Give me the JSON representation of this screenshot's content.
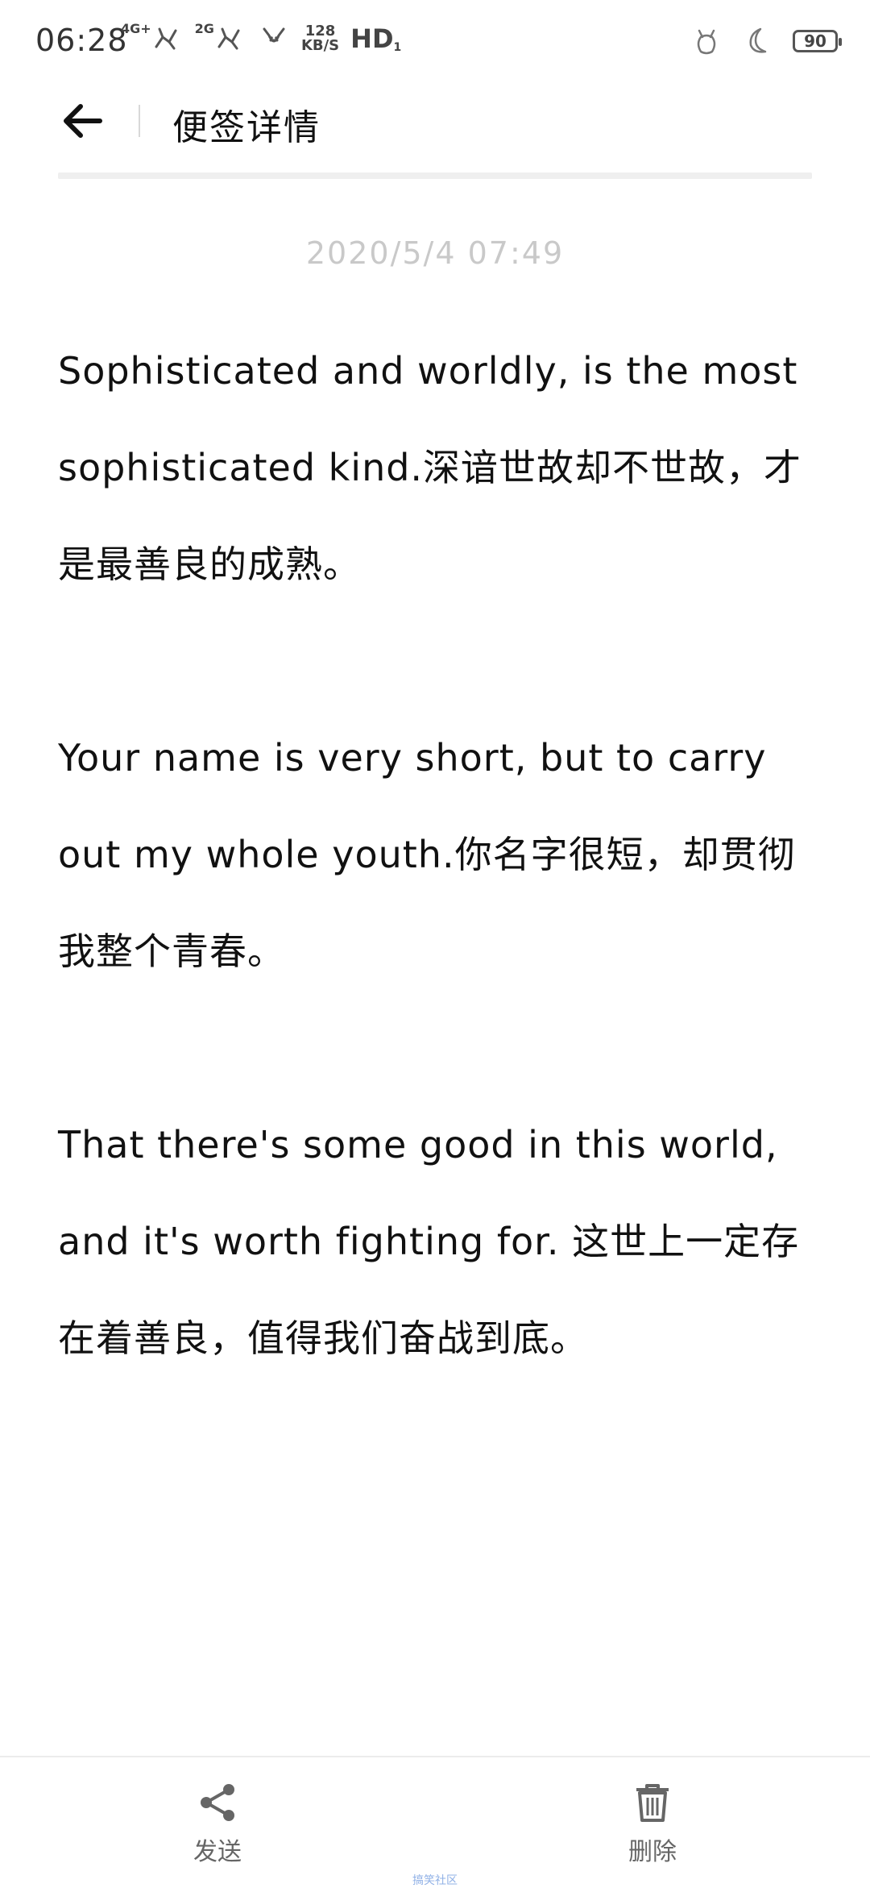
{
  "status_bar": {
    "time": "06:28",
    "net1": "4G+",
    "net2": "2G",
    "speed_value": "128",
    "speed_unit": "KB/S",
    "hd": "HD",
    "hd_sub": "1",
    "battery": "90"
  },
  "header": {
    "title": "便签详情"
  },
  "note": {
    "date": "2020/5/4 07:49",
    "paragraphs": [
      "Sophisticated and worldly, is the most sophisticated kind.深谙世故却不世故，才是最善良的成熟。",
      "Your name is very short, but to carry out my whole youth.你名字很短，却贯彻我整个青春。",
      "That there's some good in this world, and it's worth fighting for. 这世上一定存在着善良，值得我们奋战到底。"
    ]
  },
  "bottom_bar": {
    "send_label": "发送",
    "delete_label": "删除"
  },
  "watermark": "搞笑社区"
}
